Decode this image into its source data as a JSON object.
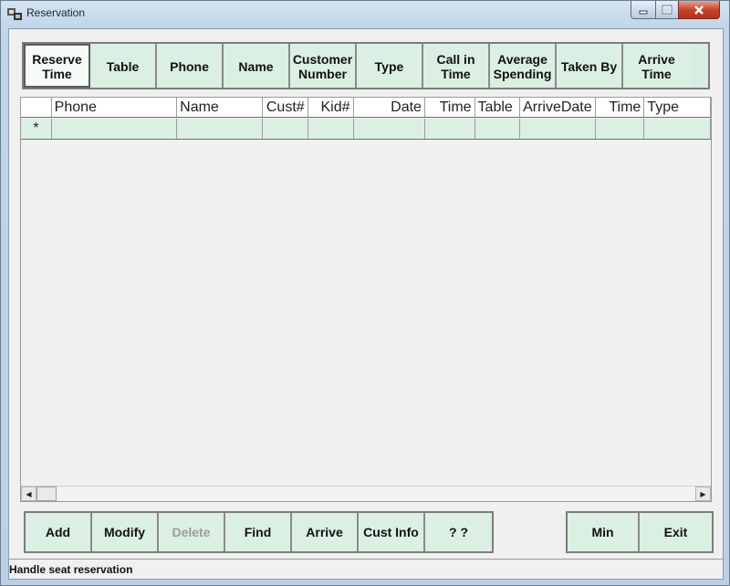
{
  "window": {
    "title": "Reservation",
    "controls": {
      "minimize": "minimize-icon",
      "maximize": "maximize-icon",
      "close": "close-icon"
    }
  },
  "sort_tabs": [
    {
      "label": "Reserve\nTime",
      "active": true
    },
    {
      "label": "Table"
    },
    {
      "label": "Phone"
    },
    {
      "label": "Name"
    },
    {
      "label": "Customer\nNumber"
    },
    {
      "label": "Type"
    },
    {
      "label": "Call in\nTime"
    },
    {
      "label": "Average\nSpending"
    },
    {
      "label": "Taken By"
    },
    {
      "label": "Arrive\nTime"
    }
  ],
  "grid": {
    "columns": [
      "Phone",
      "Name",
      "Cust#",
      "Kid#",
      "Date",
      "Time",
      "Table",
      "ArriveDate",
      "Time",
      "Type"
    ],
    "new_row_marker": "*",
    "rows": []
  },
  "buttons_left": [
    {
      "label": "Add"
    },
    {
      "label": "Modify"
    },
    {
      "label": "Delete",
      "disabled": true
    },
    {
      "label": "Find"
    },
    {
      "label": "Arrive"
    },
    {
      "label": "Cust Info"
    },
    {
      "label": "? ?"
    }
  ],
  "buttons_right": [
    {
      "label": "Min"
    },
    {
      "label": "Exit"
    }
  ],
  "status": {
    "text": "Handle seat reservation"
  },
  "colors": {
    "accent_green": "#dcefe3",
    "close_red": "#c6452f"
  }
}
